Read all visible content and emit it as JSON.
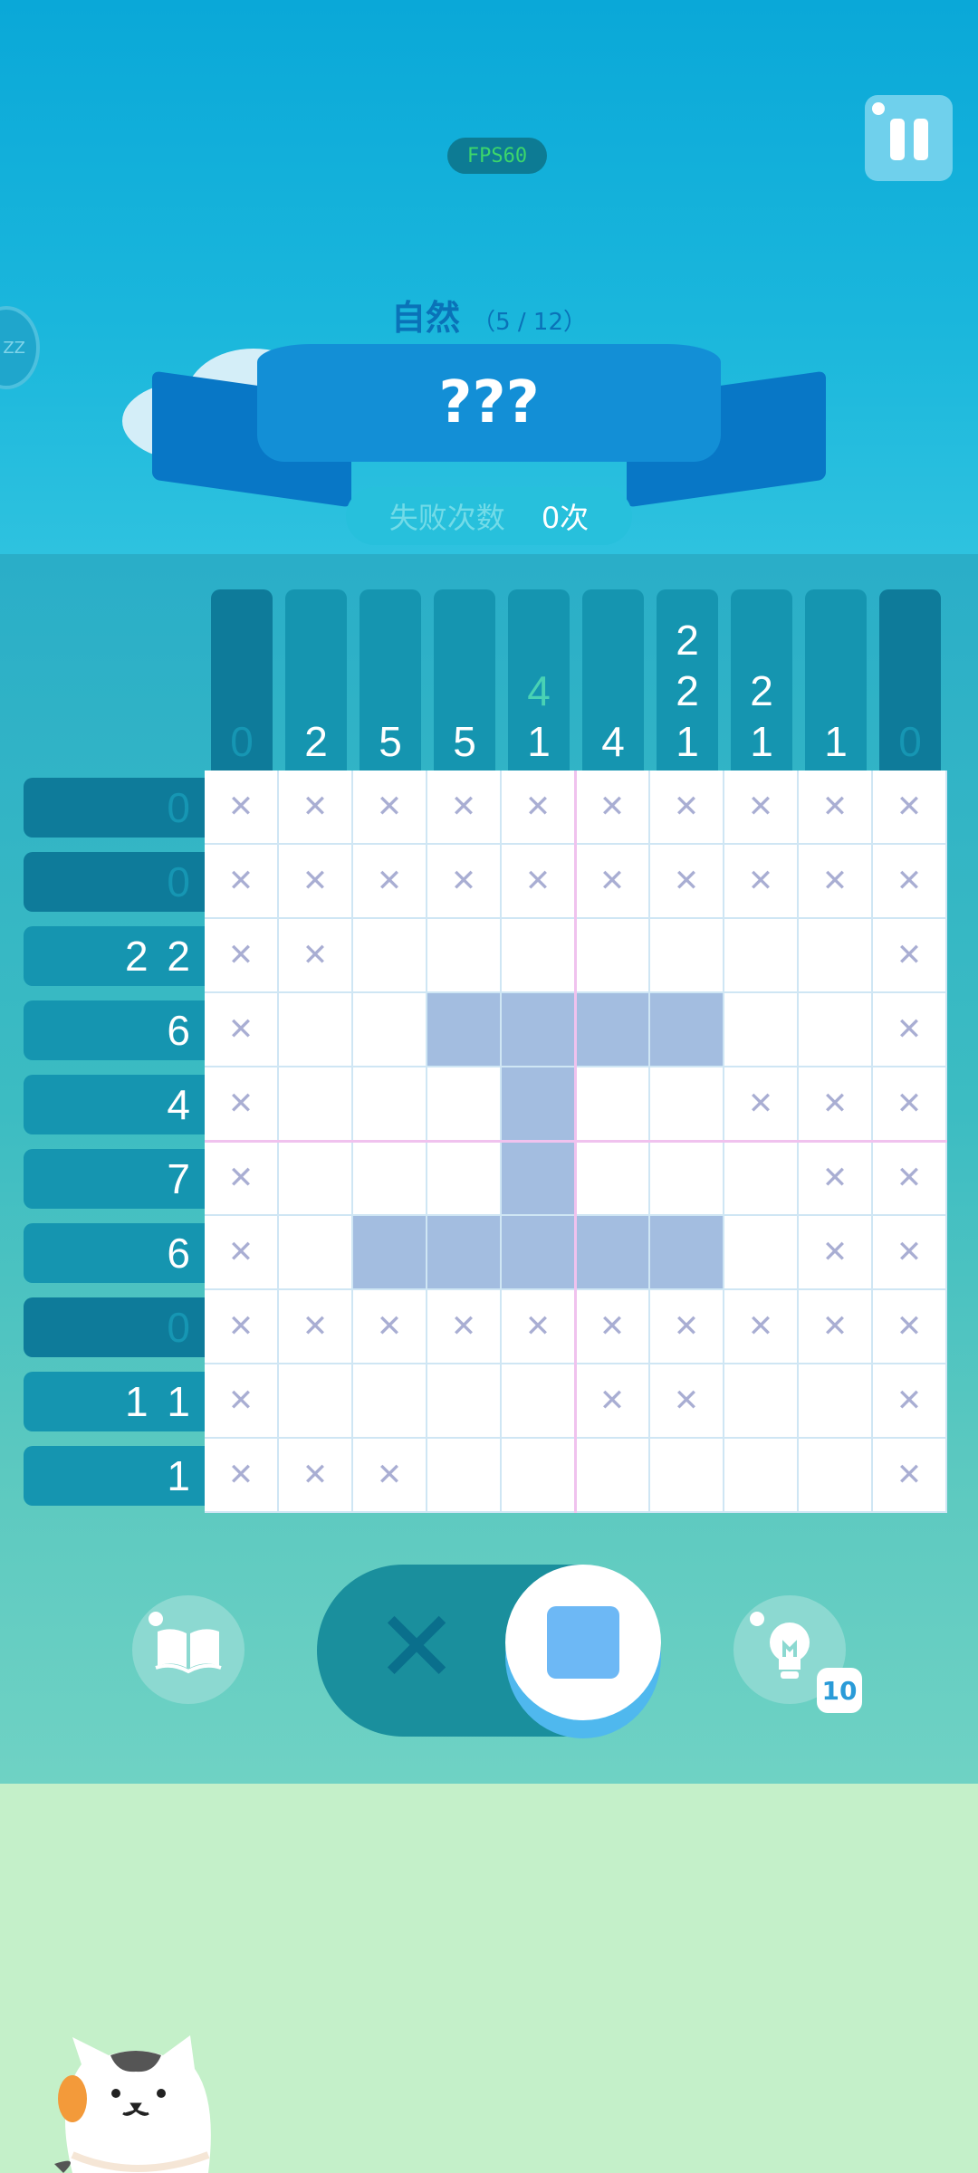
{
  "fps_label": "FPS60",
  "sleep_label": "ZZ",
  "category": {
    "name": "自然",
    "progress": "（5 / 12）"
  },
  "puzzle_title": "???",
  "fail": {
    "label": "失败次数",
    "value": "0次"
  },
  "column_clues": [
    [
      "0"
    ],
    [
      "2"
    ],
    [
      "5"
    ],
    [
      "5"
    ],
    [
      "4",
      "1"
    ],
    [
      "4"
    ],
    [
      "2",
      "2",
      "1"
    ],
    [
      "2",
      "1"
    ],
    [
      "1"
    ],
    [
      "0"
    ]
  ],
  "row_clues": [
    "0",
    "0",
    "2 2",
    "6",
    "4",
    "7",
    "6",
    "0",
    "1 1",
    "1"
  ],
  "grid": [
    "xxxxxxxxxx",
    "xxxxxxxxxx",
    "xx.......x",
    "x..####..x",
    "x...#..xxx",
    "x...#...xx",
    "x.#####.xx",
    "xxxxxxxxxx",
    "x....xx..x",
    "xxx......x"
  ],
  "hint_count": "10",
  "mode": "fill",
  "colors": {
    "filled": "#a3bde0",
    "cross": "#a9aed3",
    "accent": "#138fd6"
  }
}
